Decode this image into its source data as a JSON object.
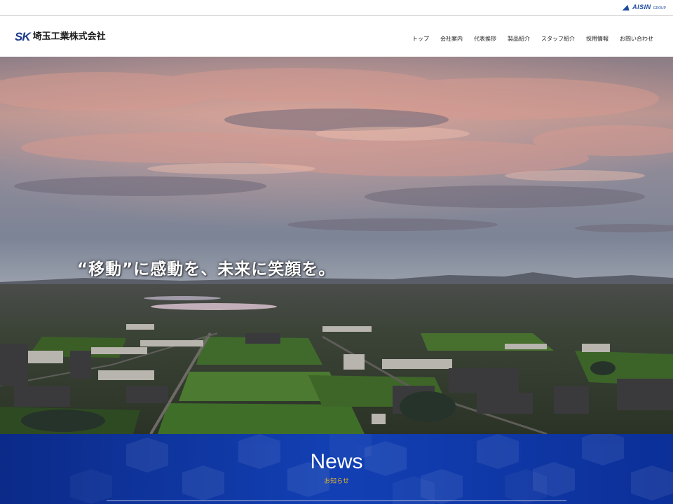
{
  "group": {
    "name": "AISIN",
    "sub": "GROUP"
  },
  "brand": {
    "mark": "SK",
    "name": "埼玉工業株式会社"
  },
  "nav": {
    "items": [
      {
        "label": "トップ"
      },
      {
        "label": "会社案内"
      },
      {
        "label": "代表挨拶"
      },
      {
        "label": "製品紹介"
      },
      {
        "label": "スタッフ紹介"
      },
      {
        "label": "採用情報"
      },
      {
        "label": "お問い合わせ"
      }
    ]
  },
  "hero": {
    "tagline": "“移動”に感動を、未来に笑顔を。"
  },
  "news": {
    "title": "News",
    "subtitle": "お知らせ"
  },
  "colors": {
    "brand": "#1e3c8c",
    "news_bg": "#1240b4",
    "news_sub": "#e0b030"
  }
}
